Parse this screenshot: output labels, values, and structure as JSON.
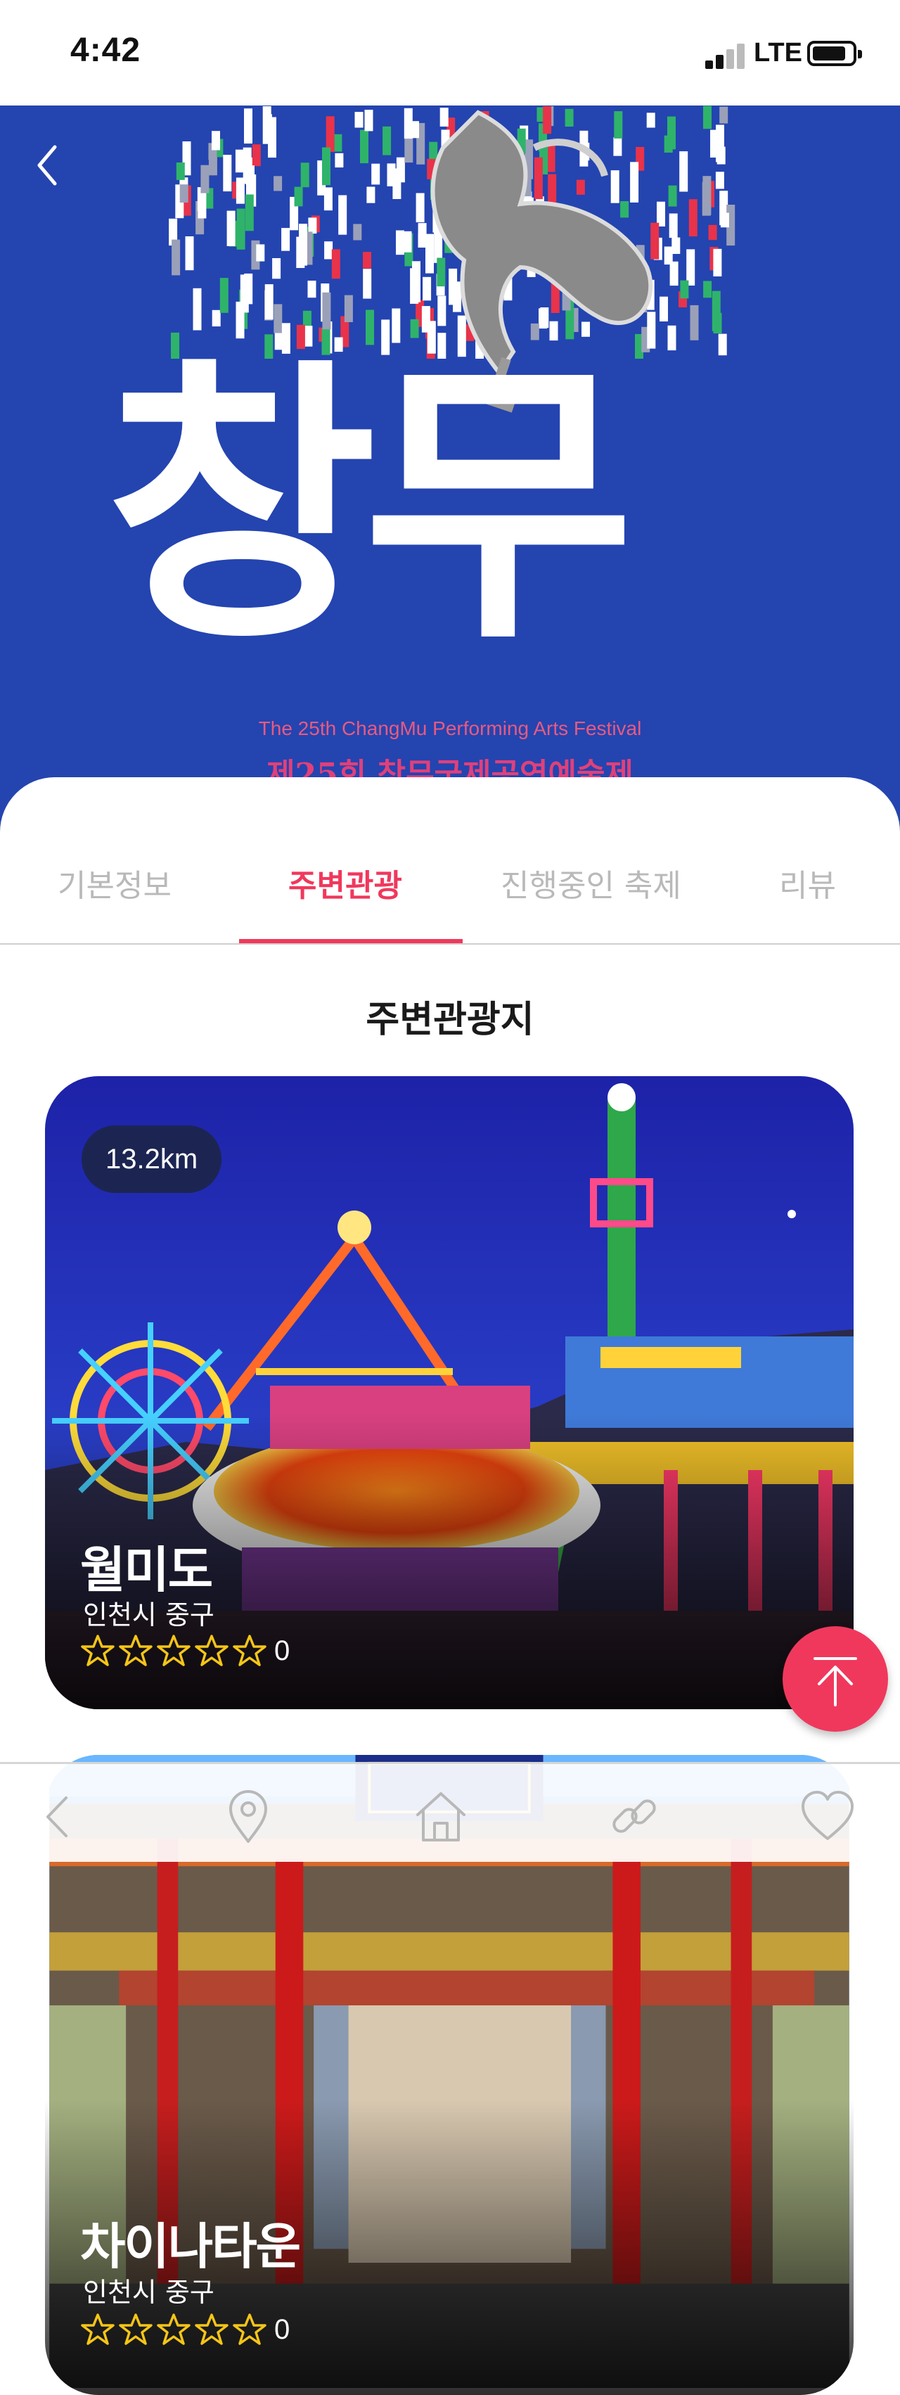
{
  "status_bar": {
    "time": "4:42",
    "network": "LTE"
  },
  "hero": {
    "poster_title": "창무",
    "poster_subtitle_en": "The 25th ChangMu Performing Arts Festival",
    "poster_subtitle_ko": "제25회 창무국제공연예술제",
    "colors": {
      "background": "#2444b0",
      "accent": "#e0407a"
    }
  },
  "tabs": [
    {
      "label": "기본정보",
      "active": false
    },
    {
      "label": "주변관광",
      "active": true
    },
    {
      "label": "진행중인 축제",
      "active": false
    },
    {
      "label": "리뷰",
      "active": false
    }
  ],
  "section_title": "주변관광지",
  "places": [
    {
      "distance": "13.2km",
      "name": "월미도",
      "location": "인천시 중구",
      "rating": "0",
      "stars": 0
    },
    {
      "name": "차이나타운",
      "location": "인천시 중구",
      "rating": "0",
      "stars": 0
    }
  ],
  "bottom_nav": [
    {
      "icon": "chevron-left-icon"
    },
    {
      "icon": "map-pin-icon"
    },
    {
      "icon": "home-icon"
    },
    {
      "icon": "link-icon"
    },
    {
      "icon": "heart-icon"
    }
  ],
  "accent_color": "#f0385c"
}
